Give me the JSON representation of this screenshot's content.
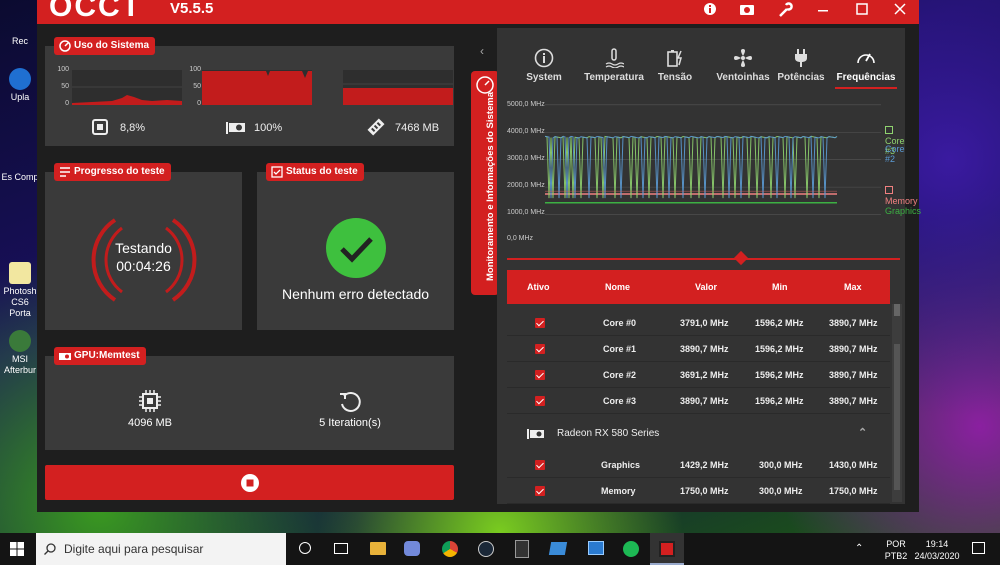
{
  "app": {
    "logo": "OCCT",
    "version": "V5.5.5"
  },
  "desktop_icons": [
    {
      "label": "Rec",
      "top": 12
    },
    {
      "label": "Upla",
      "top": 68
    },
    {
      "label": "Es Comp",
      "top": 148
    },
    {
      "label": "Photosh CS6 Porta",
      "top": 262
    },
    {
      "label": "MSI Afterbur",
      "top": 330
    }
  ],
  "system_usage": {
    "title": "Uso do Sistema",
    "cpu": {
      "value": "8,8%",
      "axis": [
        "100",
        "50",
        "0"
      ]
    },
    "gpu": {
      "value": "100%",
      "axis": [
        "100",
        "50",
        "0"
      ]
    },
    "memory": {
      "value": "7468 MB",
      "axis": [
        "10000",
        "5000",
        "0"
      ]
    }
  },
  "progress": {
    "title": "Progresso do teste",
    "status": "Testando",
    "time": "00:04:26"
  },
  "status": {
    "title": "Status  do teste",
    "message": "Nenhum erro detectado"
  },
  "gpu_memtest": {
    "title": "GPU:Memtest",
    "memory": "4096 MB",
    "iterations": "5 Iteration(s)"
  },
  "side_tab": {
    "label": "Monitoramento e Informações do Sistema"
  },
  "tabs": [
    "System",
    "Temperatura",
    "Tensão",
    "Ventoinhas",
    "Potências",
    "Frequências"
  ],
  "active_tab": "Frequências",
  "chart_data": {
    "type": "line",
    "ylabels": [
      "5000,0 MHz",
      "4000,0 MHz",
      "3000,0 MHz",
      "2000,0 MHz",
      "1000,0 MHz",
      "0,0 MHz"
    ],
    "ylim": [
      0,
      5000
    ],
    "series": [
      {
        "name": "Core #3",
        "color": "#8fd36f",
        "baseline": 3850,
        "dip": 1600
      },
      {
        "name": "Core #2",
        "color": "#5b9bd5",
        "baseline": 3850,
        "dip": 1600
      },
      {
        "name": "Memory",
        "color": "#f08080",
        "values_const": 1750
      },
      {
        "name": "Graphics",
        "color": "#3cb043",
        "values_const": 1429
      }
    ]
  },
  "legend": {
    "core3": "Core #3",
    "core2": "Core #2",
    "memory": "Memory",
    "graphics": "Graphics"
  },
  "table": {
    "headers": {
      "active": "Ativo",
      "name": "Nome",
      "value": "Valor",
      "min": "Min",
      "max": "Max"
    },
    "cpu_rows": [
      {
        "name": "Core #0",
        "value": "3791,0 MHz",
        "min": "1596,2 MHz",
        "max": "3890,7 MHz"
      },
      {
        "name": "Core #1",
        "value": "3890,7 MHz",
        "min": "1596,2 MHz",
        "max": "3890,7 MHz"
      },
      {
        "name": "Core #2",
        "value": "3691,2 MHz",
        "min": "1596,2 MHz",
        "max": "3890,7 MHz"
      },
      {
        "name": "Core #3",
        "value": "3890,7 MHz",
        "min": "1596,2 MHz",
        "max": "3890,7 MHz"
      }
    ],
    "gpu_group": "Radeon RX 580 Series",
    "gpu_rows": [
      {
        "name": "Graphics",
        "value": "1429,2 MHz",
        "min": "300,0 MHz",
        "max": "1430,0 MHz"
      },
      {
        "name": "Memory",
        "value": "1750,0 MHz",
        "min": "300,0 MHz",
        "max": "1750,0 MHz"
      }
    ]
  },
  "taskbar": {
    "search_placeholder": "Digite aqui para pesquisar",
    "lang1": "POR",
    "lang2": "PTB2",
    "time": "19:14",
    "date": "24/03/2020"
  }
}
